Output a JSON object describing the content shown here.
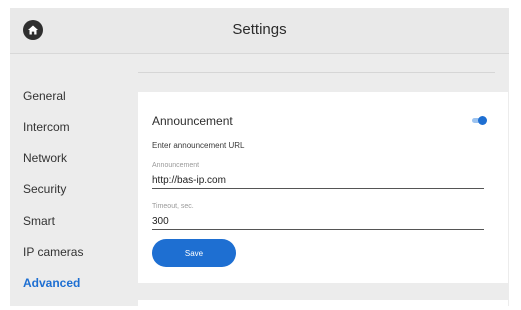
{
  "header": {
    "title": "Settings",
    "home_icon": "home-icon"
  },
  "sidebar": {
    "items": [
      {
        "label": "General",
        "active": false
      },
      {
        "label": "Intercom",
        "active": false
      },
      {
        "label": "Network",
        "active": false
      },
      {
        "label": "Security",
        "active": false
      },
      {
        "label": "Smart",
        "active": false
      },
      {
        "label": "IP cameras",
        "active": false
      },
      {
        "label": "Advanced",
        "active": true
      }
    ]
  },
  "announcement": {
    "title": "Announcement",
    "enabled": true,
    "hint": "Enter announcement URL",
    "url_label": "Announcement",
    "url_value": "http://bas-ip.com",
    "timeout_label": "Timeout, sec.",
    "timeout_value": "300",
    "save_label": "Save"
  },
  "colors": {
    "accent": "#1e6fd2",
    "background": "#ececec",
    "card": "#ffffff"
  }
}
